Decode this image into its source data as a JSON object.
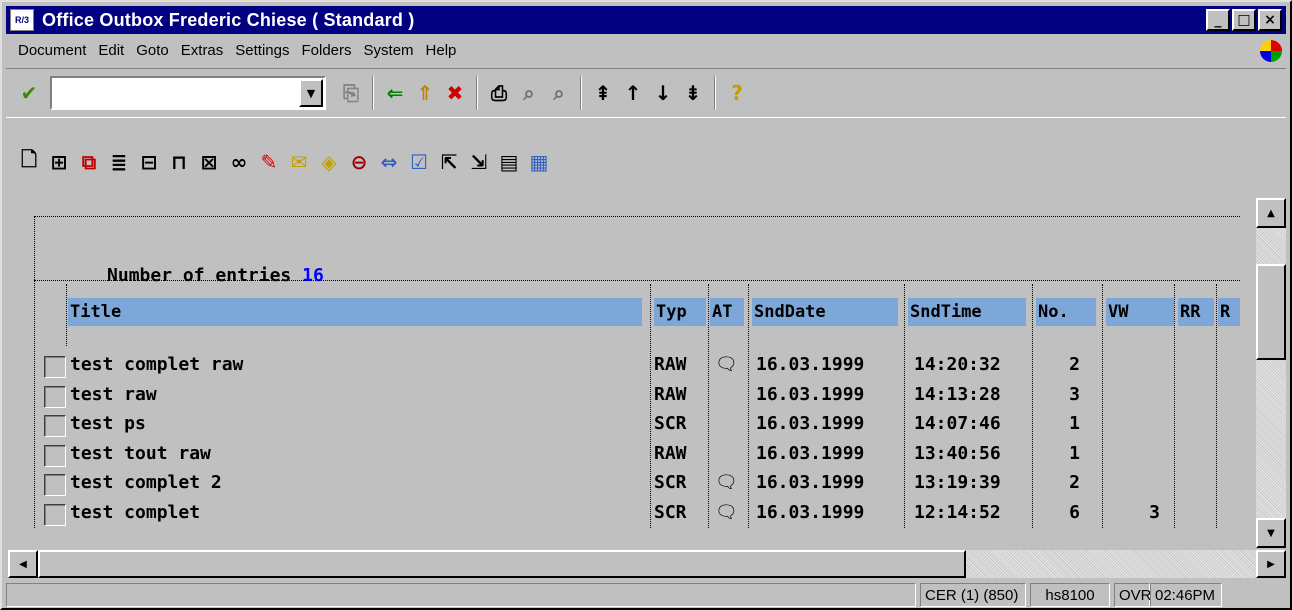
{
  "window": {
    "icon_text": "R/3",
    "title": "Office  Outbox  Frederic Chiese  ( Standard )",
    "minimize": "_",
    "maximize": "□",
    "close": "×"
  },
  "menu": [
    "Document",
    "Edit",
    "Goto",
    "Extras",
    "Settings",
    "Folders",
    "System",
    "Help"
  ],
  "toolbar": {
    "command_field": {
      "value": "",
      "placeholder": ""
    },
    "icons": [
      "enter-check-icon",
      "save-icon",
      "back-icon",
      "exit-icon",
      "cancel-icon",
      "print-icon",
      "find-icon",
      "find-next-icon",
      "first-page-icon",
      "previous-page-icon",
      "next-page-icon",
      "last-page-icon",
      "help-icon"
    ]
  },
  "app_toolbar": {
    "icons": [
      "create-document-icon",
      "distribution-list-icon",
      "copy-icon",
      "structure-icon",
      "org-chart-icon",
      "delete-icon",
      "trash-icon",
      "glasses-icon",
      "edit-pencil-icon",
      "notes-icon",
      "attributes-icon",
      "folder-icon",
      "forward-icon",
      "change-icon",
      "export-icon",
      "import-icon",
      "sort-icon",
      "layout-icon"
    ]
  },
  "list": {
    "count_label": "Number of entries",
    "count_value": "16",
    "columns": {
      "title": "Title",
      "typ": "Typ",
      "at": "AT",
      "snddate": "SndDate",
      "sndtime": "SndTime",
      "no": "No.",
      "vw": "VW",
      "rr": "RR",
      "r": "R"
    },
    "attachment_symbol": "🗨",
    "rows": [
      {
        "title": "test complet raw",
        "typ": "RAW",
        "at": "🗨",
        "snddate": "16.03.1999",
        "sndtime": "14:20:32",
        "no": "2",
        "vw": ""
      },
      {
        "title": "test raw",
        "typ": "RAW",
        "at": "",
        "snddate": "16.03.1999",
        "sndtime": "14:13:28",
        "no": "3",
        "vw": ""
      },
      {
        "title": "test ps",
        "typ": "SCR",
        "at": "",
        "snddate": "16.03.1999",
        "sndtime": "14:07:46",
        "no": "1",
        "vw": ""
      },
      {
        "title": "test tout raw",
        "typ": "RAW",
        "at": "",
        "snddate": "16.03.1999",
        "sndtime": "13:40:56",
        "no": "1",
        "vw": ""
      },
      {
        "title": "test complet 2",
        "typ": "SCR",
        "at": "🗨",
        "snddate": "16.03.1999",
        "sndtime": "13:19:39",
        "no": "2",
        "vw": ""
      },
      {
        "title": "test complet",
        "typ": "SCR",
        "at": "🗨",
        "snddate": "16.03.1999",
        "sndtime": "12:14:52",
        "no": "6",
        "vw": "3"
      }
    ]
  },
  "status": {
    "system": "CER (1) (850)",
    "server": "hs8100",
    "mode": "OVR",
    "time": "02:46PM"
  }
}
